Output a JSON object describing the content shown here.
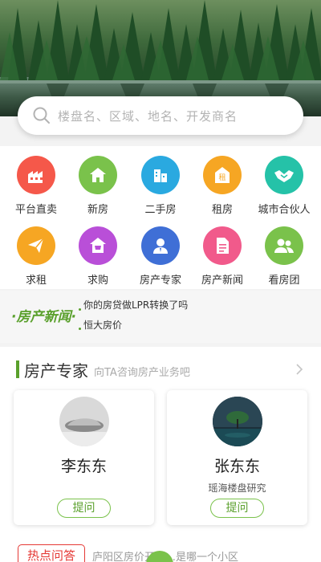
{
  "search": {
    "placeholder": "楼盘名、区域、地名、开发商名"
  },
  "grid": {
    "items": [
      {
        "label": "平台直卖",
        "icon": "factory-icon",
        "color": "#f5584a"
      },
      {
        "label": "新房",
        "icon": "house-icon",
        "color": "#7ac24b"
      },
      {
        "label": "二手房",
        "icon": "buildings-icon",
        "color": "#2aa9e0"
      },
      {
        "label": "租房",
        "icon": "rent-house-icon",
        "color": "#f6a623"
      },
      {
        "label": "城市合伙人",
        "icon": "handshake-icon",
        "color": "#25c2a8"
      },
      {
        "label": "求租",
        "icon": "paper-plane-icon",
        "color": "#f6a623"
      },
      {
        "label": "求购",
        "icon": "shop-house-icon",
        "color": "#b94fd8"
      },
      {
        "label": "房产专家",
        "icon": "expert-icon",
        "color": "#3f6fd6"
      },
      {
        "label": "房产新闻",
        "icon": "document-icon",
        "color": "#f15a8b"
      },
      {
        "label": "看房团",
        "icon": "group-icon",
        "color": "#7ac24b"
      }
    ]
  },
  "news": {
    "logo": "房产新闻",
    "lines": [
      "你的房贷做LPR转换了吗",
      "恒大房价"
    ]
  },
  "experts": {
    "title": "房产专家",
    "subtitle": "向TA咨询房产业务吧",
    "cards": [
      {
        "name": "李东东",
        "desc": "",
        "button": "提问"
      },
      {
        "name": "张东东",
        "desc": "瑶海楼盘研究",
        "button": "提问"
      }
    ]
  },
  "qa": {
    "badge": "热点问答",
    "text": "庐阳区房价开发…是哪一个小区"
  },
  "colors": {
    "accent": "#5aa02c",
    "hot": "#e53935"
  }
}
